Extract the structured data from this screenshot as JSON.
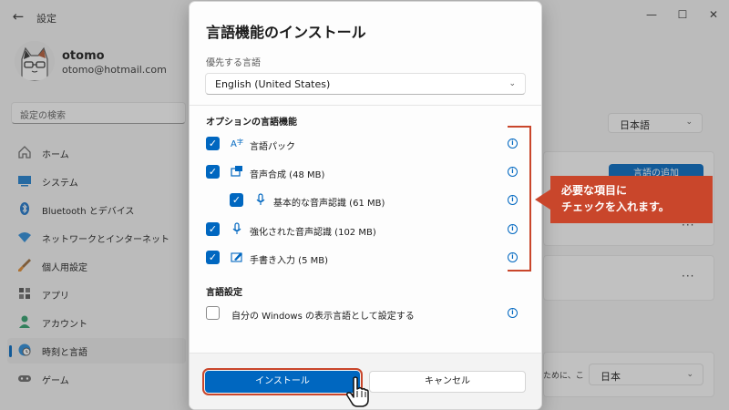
{
  "window": {
    "title": "設定",
    "back_icon": "back-arrow-icon",
    "controls": [
      "minimize-icon",
      "maximize-icon",
      "close-icon"
    ]
  },
  "profile": {
    "name": "otomo",
    "email": "otomo@hotmail.com"
  },
  "search": {
    "placeholder": "設定の検索"
  },
  "sidebar": {
    "items": [
      {
        "label": "ホーム",
        "icon": "home-icon"
      },
      {
        "label": "システム",
        "icon": "system-icon"
      },
      {
        "label": "Bluetooth とデバイス",
        "icon": "bluetooth-icon"
      },
      {
        "label": "ネットワークとインターネット",
        "icon": "wifi-icon"
      },
      {
        "label": "個人用設定",
        "icon": "brush-icon"
      },
      {
        "label": "アプリ",
        "icon": "apps-icon"
      },
      {
        "label": "アカウント",
        "icon": "account-icon"
      },
      {
        "label": "時刻と言語",
        "icon": "globe-clock-icon",
        "active": true
      },
      {
        "label": "ゲーム",
        "icon": "game-icon"
      }
    ]
  },
  "background": {
    "display_language": "日本語",
    "add_language_label": "言語の追加",
    "truncated_text": "ために、こ",
    "region_value": "日本"
  },
  "dialog": {
    "title": "言語機能のインストール",
    "preferred_label": "優先する言語",
    "preferred_value": "English (United States)",
    "optional_title": "オプションの言語機能",
    "options": [
      {
        "label": "言語パック",
        "checked": true,
        "icon": "language-pack-icon"
      },
      {
        "label": "音声合成 (48 MB)",
        "checked": true,
        "icon": "text-to-speech-icon"
      },
      {
        "label": "基本的な音声認識 (61 MB)",
        "checked": true,
        "icon": "microphone-icon"
      },
      {
        "label": "強化された音声認識 (102 MB)",
        "checked": true,
        "icon": "microphone-icon"
      },
      {
        "label": "手書き入力 (5 MB)",
        "checked": true,
        "icon": "handwriting-icon"
      }
    ],
    "settings_title": "言語設定",
    "display_lang_option": "自分の Windows の表示言語として設定する",
    "display_lang_checked": false,
    "install_label": "インストール",
    "cancel_label": "キャンセル"
  },
  "annotation": {
    "line1": "必要な項目に",
    "line2": "チェックを入れます。",
    "color": "#c9462b"
  },
  "colors": {
    "accent": "#0067c0",
    "background": "#f3f3f3"
  }
}
